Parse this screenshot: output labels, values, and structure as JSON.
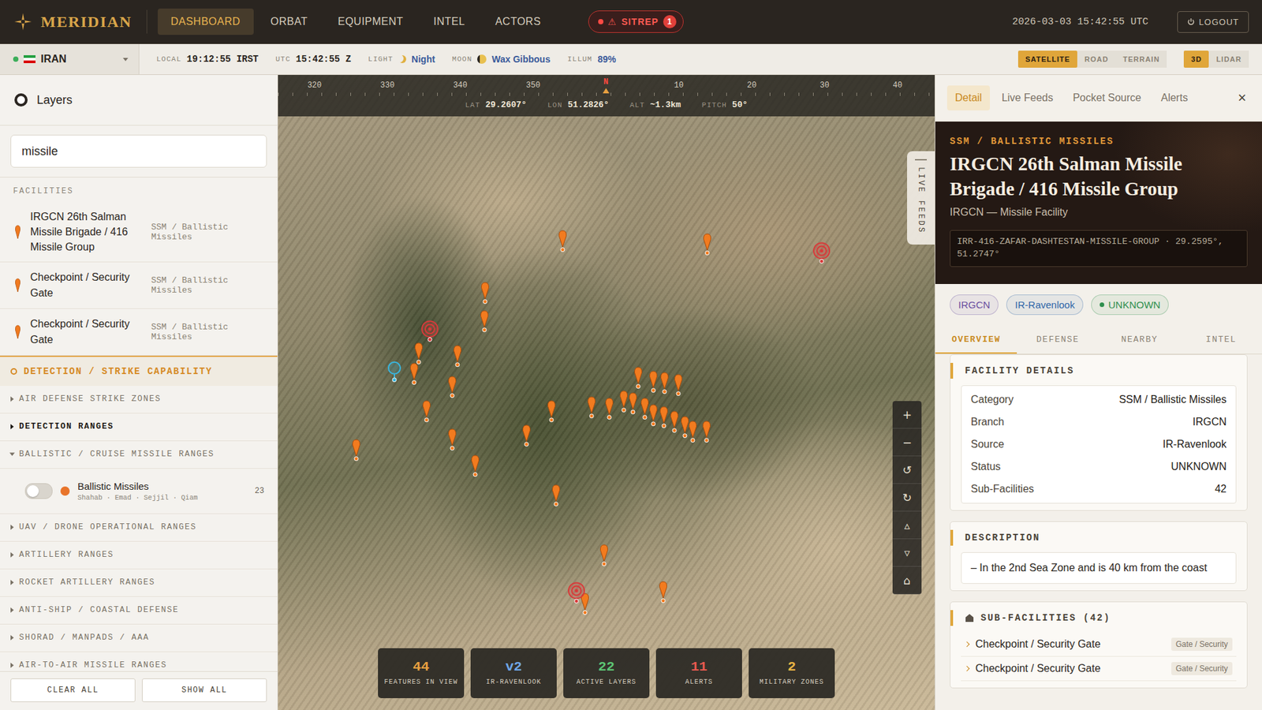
{
  "topbar": {
    "logo": "MERIDIAN",
    "nav": [
      {
        "label": "DASHBOARD",
        "selected": true
      },
      {
        "label": "ORBAT",
        "selected": false
      },
      {
        "label": "EQUIPMENT",
        "selected": false
      },
      {
        "label": "INTEL",
        "selected": false
      },
      {
        "label": "ACTORS",
        "selected": false
      }
    ],
    "sitrep": {
      "icon": "⚠",
      "label": "SITREP",
      "count": "1"
    },
    "clock": "2026-03-03 15:42:55 UTC",
    "logout": "LOGOUT"
  },
  "subbar": {
    "country": "IRAN",
    "readouts": [
      {
        "label": "LOCAL",
        "value": "19:12:55 IRST",
        "kind": "time"
      },
      {
        "label": "UTC",
        "value": "15:42:55 Z",
        "kind": "time"
      },
      {
        "label": "LIGHT",
        "value": "Night",
        "kind": "light"
      },
      {
        "label": "MOON",
        "value": "Wax Gibbous",
        "kind": "moon"
      },
      {
        "label": "ILLUM",
        "value": "89%",
        "kind": "illum"
      }
    ],
    "base_modes": [
      {
        "label": "SATELLITE",
        "selected": true
      },
      {
        "label": "ROAD",
        "selected": false
      },
      {
        "label": "TERRAIN",
        "selected": false
      }
    ],
    "view_modes": [
      {
        "label": "3D",
        "selected": true
      },
      {
        "label": "LIDAR",
        "selected": false
      }
    ]
  },
  "layers": {
    "title": "Layers",
    "search": "missile",
    "facilities_label": "FACILITIES",
    "facilities": [
      {
        "name": "IRGCN 26th Salman Missile Brigade / 416 Missile Group",
        "category": "SSM / Ballistic Missiles"
      },
      {
        "name": "Checkpoint / Security Gate",
        "category": "SSM / Ballistic Missiles"
      },
      {
        "name": "Checkpoint / Security Gate",
        "category": "SSM / Ballistic Missiles"
      }
    ],
    "strike_title": "DETECTION / STRIKE CAPABILITY",
    "groups": [
      {
        "label": "AIR DEFENSE STRIKE ZONES",
        "expanded": false,
        "highlighted": false,
        "layers": []
      },
      {
        "label": "DETECTION RANGES",
        "expanded": false,
        "highlighted": true,
        "layers": []
      },
      {
        "label": "BALLISTIC / CRUISE MISSILE RANGES",
        "expanded": true,
        "highlighted": false,
        "layers": [
          {
            "name": "Ballistic Missiles",
            "detail": "Shahab · Emad · Sejjil · Qiam",
            "count": "23",
            "on": false,
            "color": "#e8742a"
          }
        ]
      },
      {
        "label": "UAV / DRONE OPERATIONAL RANGES",
        "expanded": false,
        "highlighted": false,
        "layers": []
      },
      {
        "label": "ARTILLERY RANGES",
        "expanded": false,
        "highlighted": false,
        "layers": []
      },
      {
        "label": "ROCKET ARTILLERY RANGES",
        "expanded": false,
        "highlighted": false,
        "layers": []
      },
      {
        "label": "ANTI-SHIP / COASTAL DEFENSE",
        "expanded": false,
        "highlighted": false,
        "layers": []
      },
      {
        "label": "SHORAD / MANPADS / AAA",
        "expanded": false,
        "highlighted": false,
        "layers": []
      },
      {
        "label": "AIR-TO-AIR MISSILE RANGES",
        "expanded": false,
        "highlighted": false,
        "layers": []
      }
    ],
    "buttons": [
      "CLEAR ALL",
      "SHOW ALL"
    ]
  },
  "map": {
    "compass": [
      {
        "label": "320",
        "north": false
      },
      {
        "label": "330",
        "north": false
      },
      {
        "label": "340",
        "north": false
      },
      {
        "label": "350",
        "north": false
      },
      {
        "label": "N",
        "north": true
      },
      {
        "label": "10",
        "north": false
      },
      {
        "label": "20",
        "north": false
      },
      {
        "label": "30",
        "north": false
      },
      {
        "label": "40",
        "north": false
      }
    ],
    "readout": [
      {
        "label": "LAT",
        "value": "29.2607°"
      },
      {
        "label": "LON",
        "value": "51.2826°"
      },
      {
        "label": "ALT",
        "value": "~1.3km"
      },
      {
        "label": "PITCH",
        "value": "50°"
      }
    ],
    "live_feeds": "LIVE FEEDS",
    "controls": [
      "+",
      "−",
      "↺",
      "↻",
      "▵",
      "▿",
      "⌂"
    ],
    "stats": [
      {
        "value": "44",
        "label": "FEATURES IN VIEW",
        "color": "#e8a040"
      },
      {
        "value": "v2",
        "label": "IR-RAVENLOOK",
        "color": "#6fa6e6"
      },
      {
        "value": "22",
        "label": "ACTIVE LAYERS",
        "color": "#5cc474"
      },
      {
        "value": "11",
        "label": "ALERTS",
        "color": "#e85a50"
      },
      {
        "value": "2",
        "label": "MILITARY ZONES",
        "color": "#e8b444"
      }
    ],
    "markers": [
      {
        "kind": "pin"
      },
      {
        "kind": "pin"
      },
      {
        "kind": "pin"
      },
      {
        "kind": "pin"
      },
      {
        "kind": "pin"
      },
      {
        "kind": "pin"
      },
      {
        "kind": "pin"
      },
      {
        "kind": "pin"
      },
      {
        "kind": "pin"
      },
      {
        "kind": "pin"
      },
      {
        "kind": "pin"
      },
      {
        "kind": "pin"
      },
      {
        "kind": "pin"
      },
      {
        "kind": "pin"
      },
      {
        "kind": "pin"
      },
      {
        "kind": "pin"
      },
      {
        "kind": "pin"
      },
      {
        "kind": "pin"
      },
      {
        "kind": "pin"
      },
      {
        "kind": "pin"
      },
      {
        "kind": "pin"
      },
      {
        "kind": "pin"
      },
      {
        "kind": "pin"
      },
      {
        "kind": "pin"
      },
      {
        "kind": "pin"
      },
      {
        "kind": "pin"
      },
      {
        "kind": "pin"
      },
      {
        "kind": "pin"
      },
      {
        "kind": "pin"
      },
      {
        "kind": "pin"
      },
      {
        "kind": "pin"
      },
      {
        "kind": "pin"
      },
      {
        "kind": "pin"
      },
      {
        "kind": "target"
      },
      {
        "kind": "target"
      },
      {
        "kind": "target"
      },
      {
        "kind": "outline"
      }
    ]
  },
  "detail": {
    "tabs": [
      {
        "label": "Detail",
        "selected": true
      },
      {
        "label": "Live Feeds",
        "selected": false
      },
      {
        "label": "Pocket Source",
        "selected": false
      },
      {
        "label": "Alerts",
        "selected": false
      }
    ],
    "close": "×",
    "category": "SSM / BALLISTIC MISSILES",
    "title": "IRGCN 26th Salman Missile Brigade / 416 Missile Group",
    "subtitle": "IRGCN — Missile Facility",
    "code": "IRR-416-ZAFAR-DASHTESTAN-MISSILE-GROUP · 29.2595°, 51.2747°",
    "tags": [
      {
        "label": "IRGCN",
        "color": "#6a4fa0",
        "dot": false
      },
      {
        "label": "IR-Ravenlook",
        "color": "#2f66a8",
        "dot": false
      },
      {
        "label": "UNKNOWN",
        "color": "#2f8f4e",
        "dot": true
      }
    ],
    "subtabs": [
      {
        "label": "OVERVIEW",
        "selected": true
      },
      {
        "label": "DEFENSE",
        "selected": false
      },
      {
        "label": "NEARBY",
        "selected": false
      },
      {
        "label": "INTEL",
        "selected": false
      }
    ],
    "facility_title": "FACILITY DETAILS",
    "facility_rows": [
      {
        "key": "Category",
        "value": "SSM / Ballistic Missiles"
      },
      {
        "key": "Branch",
        "value": "IRGCN"
      },
      {
        "key": "Source",
        "value": "IR-Ravenlook"
      },
      {
        "key": "Status",
        "value": "UNKNOWN"
      },
      {
        "key": "Sub-Facilities",
        "value": "42"
      }
    ],
    "description_title": "DESCRIPTION",
    "description": "– In the 2nd Sea Zone and is 40 km from the coast",
    "subfacilities_title": "SUB-FACILITIES (42)",
    "subfacilities": [
      {
        "name": "Checkpoint / Security Gate",
        "tag": "Gate / Security"
      },
      {
        "name": "Checkpoint / Security Gate",
        "tag": "Gate / Security"
      }
    ]
  }
}
